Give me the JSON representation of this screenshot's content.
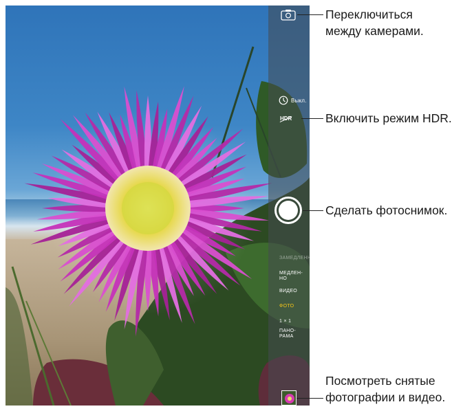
{
  "viewfinder": {
    "timer_label": "Выкл.",
    "hdr_label": "HDR",
    "modes": [
      {
        "label": "ЗАМЕДЛЕННО",
        "state": "dim"
      },
      {
        "label": "МЕДЛЕН-\nНО",
        "state": "normal"
      },
      {
        "label": "ВИДЕО",
        "state": "normal"
      },
      {
        "label": "ФОТО",
        "state": "active"
      },
      {
        "label": "1 × 1",
        "state": "normal"
      },
      {
        "label": "ПАНО-\nРАМА",
        "state": "normal"
      }
    ],
    "active_mode_color": "#f5c518"
  },
  "callouts": {
    "switch_camera": {
      "line1": "Переключиться",
      "line2": "между камерами."
    },
    "hdr": {
      "line1": "Включить режим HDR."
    },
    "shutter": {
      "line1": "Сделать фотоснимок."
    },
    "library": {
      "line1": "Посмотреть снятые",
      "line2": "фотографии и видео."
    }
  },
  "icons": {
    "switch_camera": "camera-flip-icon",
    "timer": "timer-icon",
    "hdr": "hdr-icon",
    "shutter": "shutter-button",
    "thumbnail": "photo-thumbnail"
  }
}
